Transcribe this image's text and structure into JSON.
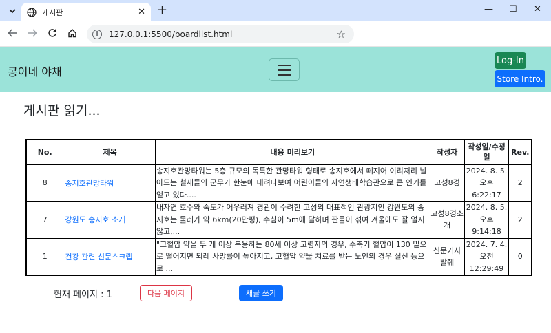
{
  "browser": {
    "tab_title": "게시판",
    "tab_menu_icon": "chevron-down-icon",
    "new_tab": "+",
    "url": "127.0.0.1:5500/boardlist.html",
    "window_controls": {
      "minimize": "—",
      "maximize": "☐",
      "close": "✕"
    }
  },
  "header": {
    "brand": "콩이네 야채",
    "login_label": "Log-In",
    "intro_label": "Store Intro."
  },
  "page": {
    "title": "게시판 읽기..."
  },
  "table": {
    "headers": [
      "No.",
      "제목",
      "내용 미리보기",
      "작성자",
      "작성일/수정일",
      "Rev."
    ],
    "rows": [
      {
        "no": "8",
        "title": "송지호관망타워",
        "preview": "송지호관망타워는 5층 규모의 독특한 관망타워 형태로 송지호에서 떼지어 이리저리 날아드는 철새들의 군무가 한눈에 내려다보여 어린이들의 자연생태학습관으로 큰 인기를 얻고 있다....",
        "author": "고성8경",
        "date": "2024. 8. 5. 오후 6:22:17",
        "rev": "2"
      },
      {
        "no": "7",
        "title": "강원도 송지호 소개",
        "preview": "내자연 호수와 죽도가 어우러져 경관이 수려한 고성의 대표적인 관광지인 강원도의 송지호는 둘레가 약 6km(20만평), 수심이 5m에 달하며 짠물이 섞여 겨울에도 잘 얼지 않고,...",
        "author": "고성8경소개",
        "date": "2024. 8. 5. 오후 9:14:18",
        "rev": "2"
      },
      {
        "no": "1",
        "title": "건강 관련 신문스크랩",
        "preview": "\"고혈압 약을 두 개 이상 복용하는 80세 이상 고령자의 경우, 수축기 혈압이 130 밑으로 떨어지면 되레 사망률이 높아지고, 고혈압 약물 치료를 받는 노인의 경우 실신 등으로 ...",
        "author": "신문기사발췌",
        "date": "2024. 7. 4. 오전 12:29:49",
        "rev": "0"
      }
    ]
  },
  "pager": {
    "current_label": "현재 페이지 : 1",
    "next_label": "다음 페이지",
    "write_label": "새글 쓰기"
  },
  "colors": {
    "header_bg": "#9be3d9",
    "login_bg": "#198754",
    "primary": "#0d6efd",
    "danger": "#dc3545"
  }
}
